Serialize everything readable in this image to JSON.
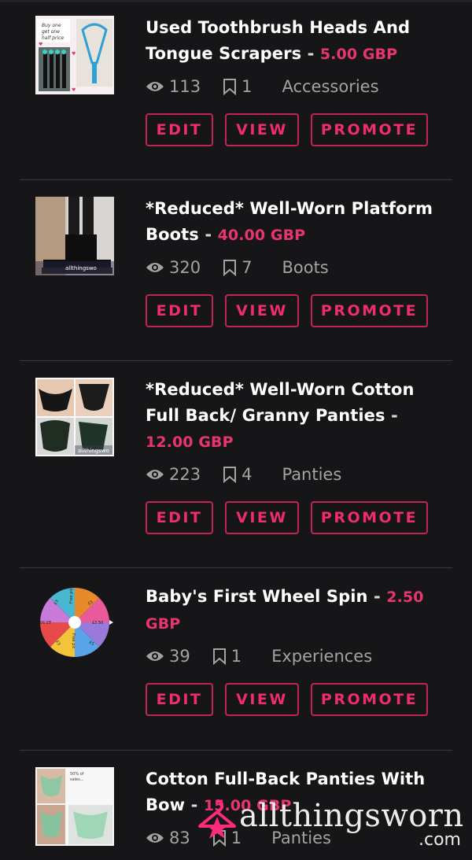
{
  "listings": [
    {
      "title": "Used Toothbrush Heads And Tongue Scrapers",
      "separator": "-",
      "price": "5.00 GBP",
      "views": "113",
      "saves": "1",
      "category": "Accessories",
      "thumb": "toothbrush-photo"
    },
    {
      "title": "*Reduced* Well-Worn Platform Boots",
      "separator": "-",
      "price": "40.00 GBP",
      "views": "320",
      "saves": "7",
      "category": "Boots",
      "thumb": "boots-photo",
      "thumb_caption": "allthingswo"
    },
    {
      "title": "*Reduced* Well-Worn Cotton Full Back/ Granny Panties",
      "separator": "-",
      "price": "12.00 GBP",
      "views": "223",
      "saves": "4",
      "category": "Panties",
      "thumb": "panties-collage",
      "thumb_caption": "allthingswo"
    },
    {
      "title": "Baby's First Wheel Spin",
      "separator": "-",
      "price": "2.50 GBP",
      "views": "39",
      "saves": "1",
      "category": "Experiences",
      "thumb": "prize-wheel",
      "wheel_labels": [
        "£3",
        "Free pic",
        "£5",
        "£2.50",
        "£5",
        "Free pic",
        "£3",
        "£2.50"
      ]
    },
    {
      "title": "Cotton Full-Back Panties With Bow",
      "separator": "-",
      "price": "15.00 GBP",
      "views": "83",
      "saves": "1",
      "category": "Panties",
      "thumb": "cotton-panties-collage"
    }
  ],
  "buttons": {
    "edit": "EDIT",
    "view": "VIEW",
    "promote": "PROMOTE"
  },
  "watermark": {
    "brand": "allthingsworn",
    "tld": ".com"
  },
  "colors": {
    "accent": "#e8356f",
    "background": "#161618",
    "muted": "#a3a3a3"
  }
}
